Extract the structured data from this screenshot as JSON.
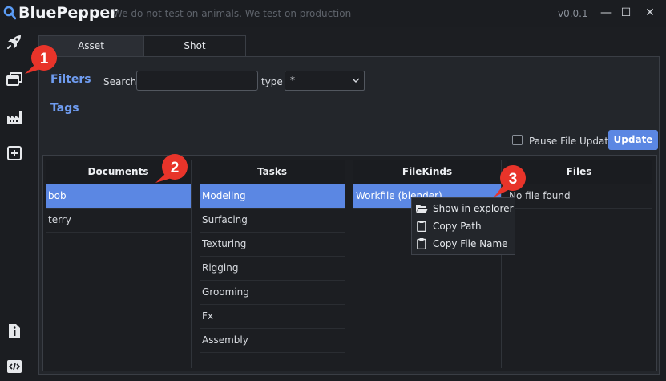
{
  "title_bar": {
    "app_name": "BluePepper",
    "tagline": "We do not test on animals. We test on production",
    "version": "v0.0.1",
    "min_glyph": "—",
    "max_glyph": "☐",
    "close_glyph": "✕"
  },
  "sidebar": {
    "items": [
      {
        "name": "launch",
        "icon": "rocket-icon"
      },
      {
        "name": "browser",
        "icon": "windows-icon"
      },
      {
        "name": "production",
        "icon": "factory-icon"
      },
      {
        "name": "new",
        "icon": "add-icon"
      },
      {
        "name": "info",
        "icon": "file-info-icon"
      },
      {
        "name": "code",
        "icon": "code-icon"
      }
    ]
  },
  "tabs": [
    "Asset",
    "Shot"
  ],
  "filters": {
    "title": "Filters",
    "search_label": "Search",
    "search_value": "",
    "type_label": "type",
    "type_value": "*"
  },
  "tags_title": "Tags",
  "pause_label": "Pause File Update",
  "update_label": "Update",
  "columns": [
    {
      "header": "Documents",
      "rows": [
        "bob",
        "terry"
      ],
      "selected": 0
    },
    {
      "header": "Tasks",
      "rows": [
        "Modeling",
        "Surfacing",
        "Texturing",
        "Rigging",
        "Grooming",
        "Fx",
        "Assembly"
      ],
      "selected": 0
    },
    {
      "header": "FileKinds",
      "rows": [
        "Workfile (blender)"
      ],
      "selected": 0
    },
    {
      "header": "Files",
      "rows": [
        "No file found"
      ],
      "selected": -1
    }
  ],
  "context_menu": [
    {
      "label": "Show in explorer",
      "icon": "folder-open-icon"
    },
    {
      "label": "Copy Path",
      "icon": "clipboard-icon"
    },
    {
      "label": "Copy File Name",
      "icon": "clipboard-icon"
    }
  ],
  "badges": [
    "1",
    "2",
    "3"
  ],
  "colors": {
    "accent": "#5b87e3",
    "section_title": "#6f9cf0",
    "badge": "#e8342a"
  }
}
